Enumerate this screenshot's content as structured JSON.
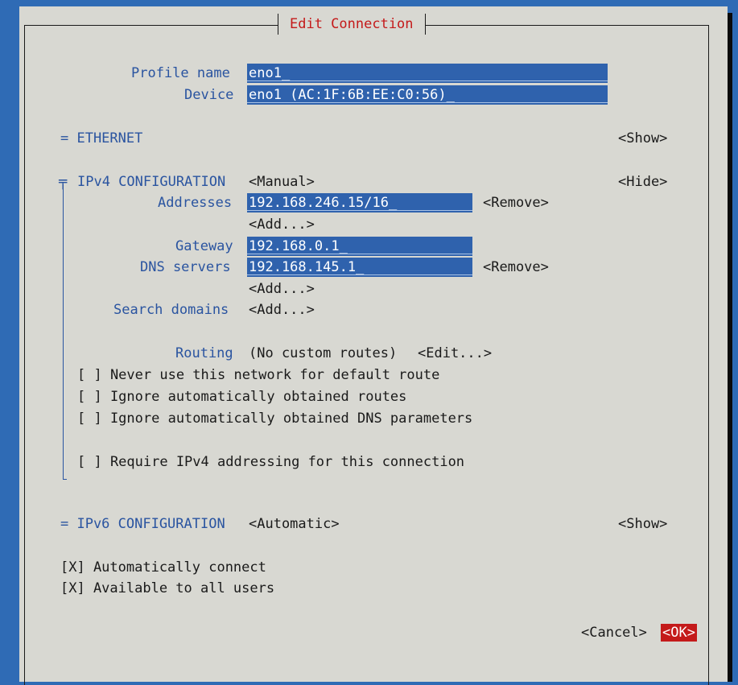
{
  "dialog": {
    "title": "Edit Connection"
  },
  "profile": {
    "label": "Profile name",
    "value": "eno1_"
  },
  "device": {
    "label": "Device",
    "value": "eno1 (AC:1F:6B:EE:C0:56)_"
  },
  "ethernet": {
    "label": "= ETHERNET",
    "toggle": "<Show>"
  },
  "ipv4": {
    "marker": "╤",
    "label": "IPv4 CONFIGURATION",
    "mode": "<Manual>",
    "toggle": "<Hide>",
    "addresses_label": "Addresses",
    "address_value": "192.168.246.15/16_",
    "remove": "<Remove>",
    "add": "<Add...>",
    "gateway_label": "Gateway",
    "gateway_value": "192.168.0.1_",
    "dns_label": "DNS servers",
    "dns_value": "192.168.145.1_",
    "search_label": "Search domains",
    "routing_label": "Routing",
    "routing_value": "(No custom routes)",
    "routing_edit": "<Edit...>",
    "checks": [
      "[ ] Never use this network for default route",
      "[ ] Ignore automatically obtained routes",
      "[ ] Ignore automatically obtained DNS parameters",
      "[ ] Require IPv4 addressing for this connection"
    ]
  },
  "ipv6": {
    "label": "= IPv6 CONFIGURATION",
    "mode": "<Automatic>",
    "toggle": "<Show>"
  },
  "options": {
    "auto_connect": "[X] Automatically connect",
    "all_users": "[X] Available to all users"
  },
  "buttons": {
    "cancel": "<Cancel>",
    "ok": "<OK>"
  },
  "colors": {
    "background": "#2f6bb5",
    "dialog": "#d8d8d2",
    "field": "#2f62ad",
    "label": "#2a54a0",
    "title": "#c41a1a",
    "ok_bg": "#c41a1a"
  }
}
